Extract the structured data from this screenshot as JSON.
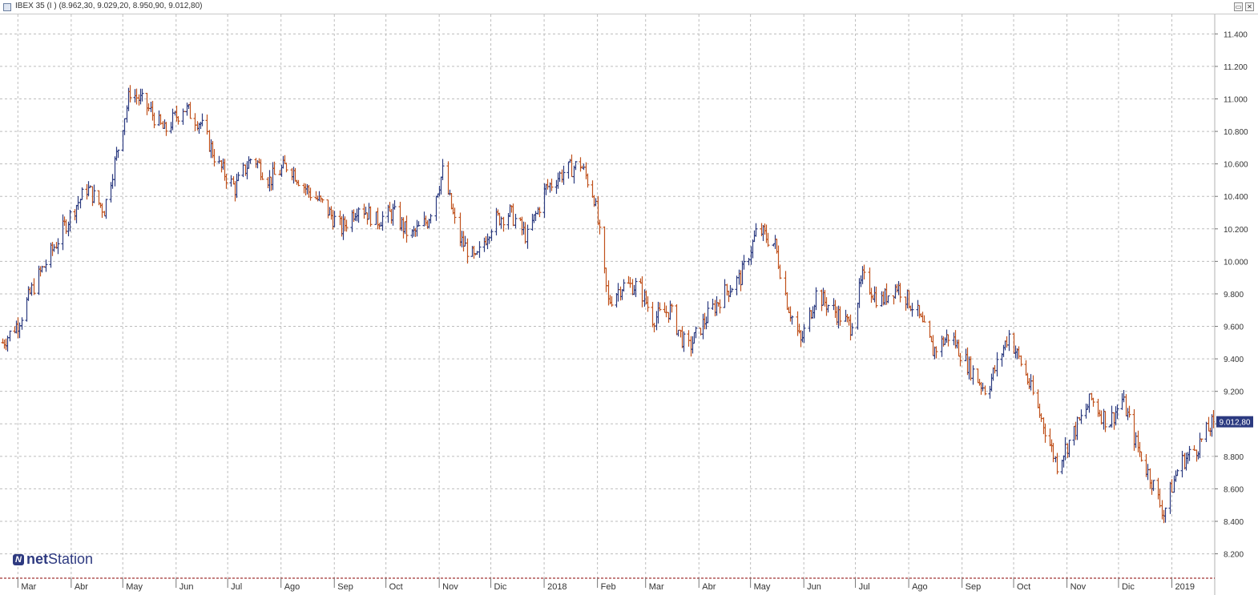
{
  "window": {
    "title": "IBEX 35 (I ) (8.962,30, 9.029,20, 8.950,90, 9.012,80)",
    "restore_label": "▭",
    "close_label": "✕"
  },
  "logo": {
    "part1": "net",
    "part2": "Station"
  },
  "last_price_label": "9.012,80",
  "colors": {
    "up": "#2b3a80",
    "down": "#c0511c",
    "grid": "#bdbdbd",
    "badge": "#2b3a80",
    "axis_border": "#8b0000"
  },
  "chart_data": {
    "type": "ohlc",
    "title": "IBEX 35 (I )",
    "ylim": [
      8050,
      11520
    ],
    "y_ticks": [
      8200,
      8400,
      8600,
      8800,
      9000,
      9200,
      9400,
      9600,
      9800,
      10000,
      10200,
      10400,
      10600,
      10800,
      11000,
      11200,
      11400
    ],
    "y_tick_labels": [
      "8.200",
      "8.400",
      "8.600",
      "8.800",
      "9.000",
      "9.200",
      "9.400",
      "9.600",
      "9.800",
      "10.000",
      "10.200",
      "10.400",
      "10.600",
      "10.800",
      "11.000",
      "11.200",
      "11.400"
    ],
    "x_range": [
      "2017-02-20",
      "2019-01-25"
    ],
    "x_ticks": [
      {
        "label": "Mar",
        "date": "2017-03-01"
      },
      {
        "label": "Abr",
        "date": "2017-04-01"
      },
      {
        "label": "May",
        "date": "2017-05-01"
      },
      {
        "label": "Jun",
        "date": "2017-06-01"
      },
      {
        "label": "Jul",
        "date": "2017-07-01"
      },
      {
        "label": "Ago",
        "date": "2017-08-01"
      },
      {
        "label": "Sep",
        "date": "2017-09-01"
      },
      {
        "label": "Oct",
        "date": "2017-10-01"
      },
      {
        "label": "Nov",
        "date": "2017-11-01"
      },
      {
        "label": "Dic",
        "date": "2017-12-01"
      },
      {
        "label": "2018",
        "date": "2018-01-01"
      },
      {
        "label": "Feb",
        "date": "2018-02-01"
      },
      {
        "label": "Mar",
        "date": "2018-03-01"
      },
      {
        "label": "Abr",
        "date": "2018-04-01"
      },
      {
        "label": "May",
        "date": "2018-05-01"
      },
      {
        "label": "Jun",
        "date": "2018-06-01"
      },
      {
        "label": "Jul",
        "date": "2018-07-01"
      },
      {
        "label": "Ago",
        "date": "2018-08-01"
      },
      {
        "label": "Sep",
        "date": "2018-09-01"
      },
      {
        "label": "Oct",
        "date": "2018-10-01"
      },
      {
        "label": "Nov",
        "date": "2018-11-01"
      },
      {
        "label": "Dic",
        "date": "2018-12-01"
      },
      {
        "label": "2019",
        "date": "2019-01-01"
      }
    ],
    "grid": true,
    "last_value": 9012.8,
    "series_anchors": [
      [
        "2017-02-20",
        9500
      ],
      [
        "2017-03-01",
        9620
      ],
      [
        "2017-03-10",
        9850
      ],
      [
        "2017-03-20",
        10050
      ],
      [
        "2017-04-01",
        10300
      ],
      [
        "2017-04-10",
        10450
      ],
      [
        "2017-04-20",
        10320
      ],
      [
        "2017-04-28",
        10700
      ],
      [
        "2017-05-05",
        11050
      ],
      [
        "2017-05-15",
        10950
      ],
      [
        "2017-05-25",
        10800
      ],
      [
        "2017-06-05",
        10950
      ],
      [
        "2017-06-15",
        10850
      ],
      [
        "2017-06-25",
        10600
      ],
      [
        "2017-07-05",
        10450
      ],
      [
        "2017-07-15",
        10650
      ],
      [
        "2017-07-25",
        10500
      ],
      [
        "2017-08-05",
        10600
      ],
      [
        "2017-08-15",
        10450
      ],
      [
        "2017-08-25",
        10350
      ],
      [
        "2017-09-05",
        10200
      ],
      [
        "2017-09-15",
        10350
      ],
      [
        "2017-09-25",
        10250
      ],
      [
        "2017-10-05",
        10300
      ],
      [
        "2017-10-15",
        10150
      ],
      [
        "2017-10-25",
        10250
      ],
      [
        "2017-11-03",
        10550
      ],
      [
        "2017-11-12",
        10150
      ],
      [
        "2017-11-22",
        10000
      ],
      [
        "2017-12-02",
        10250
      ],
      [
        "2017-12-12",
        10300
      ],
      [
        "2017-12-22",
        10150
      ],
      [
        "2018-01-02",
        10450
      ],
      [
        "2018-01-12",
        10550
      ],
      [
        "2018-01-22",
        10600
      ],
      [
        "2018-01-30",
        10400
      ],
      [
        "2018-02-07",
        9750
      ],
      [
        "2018-02-15",
        9850
      ],
      [
        "2018-02-25",
        9850
      ],
      [
        "2018-03-05",
        9650
      ],
      [
        "2018-03-15",
        9700
      ],
      [
        "2018-03-25",
        9450
      ],
      [
        "2018-04-05",
        9650
      ],
      [
        "2018-04-15",
        9800
      ],
      [
        "2018-04-25",
        9900
      ],
      [
        "2018-05-05",
        10200
      ],
      [
        "2018-05-15",
        10100
      ],
      [
        "2018-05-22",
        9750
      ],
      [
        "2018-05-30",
        9500
      ],
      [
        "2018-06-08",
        9800
      ],
      [
        "2018-06-18",
        9700
      ],
      [
        "2018-06-28",
        9600
      ],
      [
        "2018-07-05",
        9900
      ],
      [
        "2018-07-15",
        9750
      ],
      [
        "2018-07-25",
        9850
      ],
      [
        "2018-08-05",
        9700
      ],
      [
        "2018-08-15",
        9450
      ],
      [
        "2018-08-25",
        9550
      ],
      [
        "2018-09-05",
        9350
      ],
      [
        "2018-09-15",
        9200
      ],
      [
        "2018-09-28",
        9550
      ],
      [
        "2018-10-08",
        9300
      ],
      [
        "2018-10-18",
        9000
      ],
      [
        "2018-10-26",
        8750
      ],
      [
        "2018-11-05",
        8950
      ],
      [
        "2018-11-15",
        9150
      ],
      [
        "2018-11-25",
        9000
      ],
      [
        "2018-12-03",
        9150
      ],
      [
        "2018-12-12",
        8850
      ],
      [
        "2018-12-20",
        8650
      ],
      [
        "2018-12-27",
        8450
      ],
      [
        "2019-01-05",
        8750
      ],
      [
        "2019-01-15",
        8850
      ],
      [
        "2019-01-25",
        9012.8
      ]
    ]
  }
}
